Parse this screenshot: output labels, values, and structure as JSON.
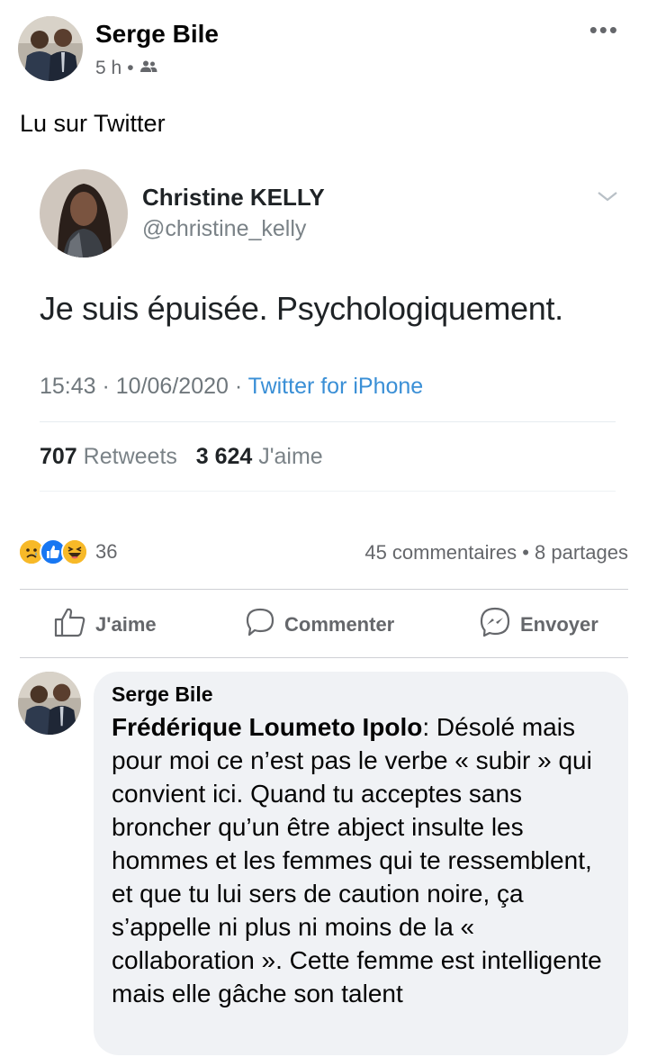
{
  "post": {
    "author": "Serge Bile",
    "time": "5 h",
    "separator": "•",
    "audience_icon": "friends-icon",
    "text": "Lu sur Twitter"
  },
  "tweet": {
    "name": "Christine KELLY",
    "handle": "@christine_kelly",
    "text": "Je suis épuisée. Psychologiquement.",
    "time": "15:43 · 10/06/2020 · ",
    "source": "Twitter for iPhone",
    "retweets_count": "707",
    "retweets_label": "Retweets",
    "likes_count": "3 624",
    "likes_label": "J'aime"
  },
  "reactions": {
    "icons": [
      "sad-reaction-icon",
      "like-reaction-icon",
      "haha-reaction-icon"
    ],
    "count": "36",
    "comments": "45 commentaires",
    "dot": "•",
    "shares": "8 partages"
  },
  "actions": {
    "like": "J'aime",
    "comment": "Commenter",
    "send": "Envoyer"
  },
  "comment": {
    "author": "Serge Bile",
    "mention": "Frédérique Loumeto Ipolo",
    "text": ": Désolé mais pour moi ce n’est pas le verbe « subir » qui convient ici. Quand tu acceptes sans broncher qu’un être abject insulte les hommes et les femmes qui te ressemblent, et que tu lui sers de caution noire, ça s’appelle ni plus ni moins de la « collaboration ». Cette femme est intelligente mais elle gâche son talent"
  },
  "colors": {
    "facebook_gray": "#65676b",
    "twitter_blue": "#3a8fd6",
    "like_blue": "#1877f2",
    "bubble_bg": "#f0f2f5"
  }
}
